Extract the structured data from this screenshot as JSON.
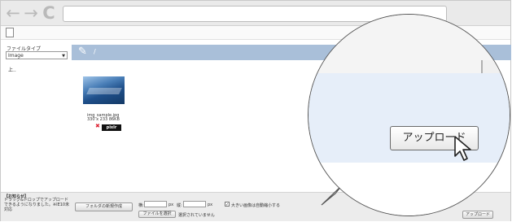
{
  "browser": {
    "back_icon": "←",
    "forward_icon": "→",
    "reload_icon": "C",
    "address": ""
  },
  "sidebar": {
    "filetype_label": "ファイルタイプ",
    "filetype_value": "Image",
    "up_folder": "上.."
  },
  "header": {
    "path": "/"
  },
  "file": {
    "name": "img_sample.jpg",
    "meta": "330 x 233 86KB",
    "pixlr_label": "pixlr"
  },
  "footer": {
    "notice_title": "【お知らせ】",
    "notice_text": "ドラッグ&ドロップでアップロードできるようになりました。※IE10未対応",
    "new_folder_button": "フォルダの新規作成",
    "width_label": "横:",
    "width_value": "",
    "width_unit": "px",
    "height_label": "縦:",
    "height_value": "",
    "height_unit": "px",
    "resize_checked": "✓",
    "resize_label": "大きい画像は自動縮小する",
    "choose_file_button": "ファイルを選択",
    "no_file_text": "選択されていません",
    "upload_button": "アップロード"
  },
  "magnifier": {
    "upload_button": "アップロード"
  },
  "colors": {
    "header_bar": "#a9bfd9",
    "magnified_panel": "#e6eef9"
  }
}
